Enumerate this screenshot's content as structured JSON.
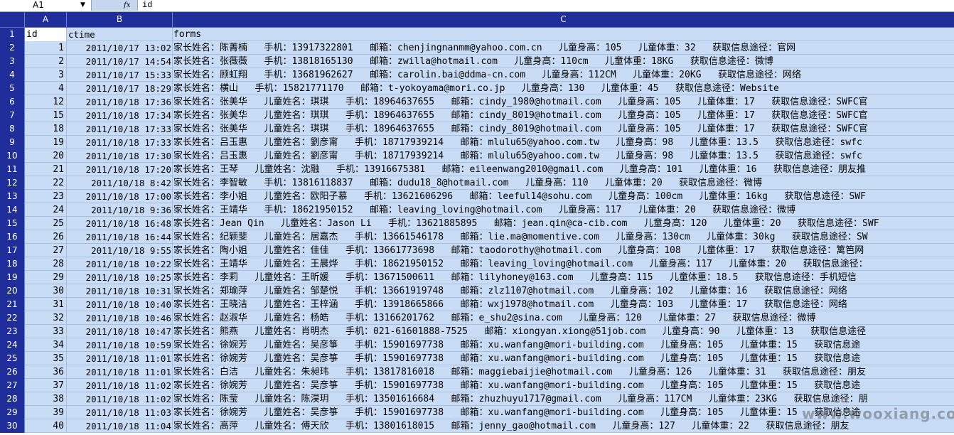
{
  "formula_bar": {
    "name_box": "A1",
    "fx_label": "fx",
    "formula": "id"
  },
  "columns": [
    "A",
    "B",
    "C"
  ],
  "header_row": {
    "row_num": "1",
    "a": "id",
    "b": "ctime",
    "c": "forms"
  },
  "rows": [
    {
      "n": "2",
      "a": "1",
      "b": "2011/10/17 13:02",
      "c": "家长姓名：陈菁楠   手机：13917322801   邮箱：chenjingnanmm@yahoo.com.cn   儿童身高：105   儿童体重：32   获取信息途径：官网"
    },
    {
      "n": "3",
      "a": "2",
      "b": "2011/10/17 14:54",
      "c": "家长姓名：张薇薇   手机：13818165130   邮箱：zwilla@hotmail.com   儿童身高：110cm   儿童体重：18KG   获取信息途径：微博"
    },
    {
      "n": "4",
      "a": "3",
      "b": "2011/10/17 15:33",
      "c": "家长姓名：顾虹翔   手机：13681962627   邮箱：carolin.bai@ddma-cn.com   儿童身高：112CM   儿童体重：20KG   获取信息途径：网络"
    },
    {
      "n": "5",
      "a": "4",
      "b": "2011/10/17 18:29",
      "c": "家长姓名：横山   手机：15821771170   邮箱：t-yokoyama@mori.co.jp   儿童身高：130   儿童体重：45   获取信息途径：Website"
    },
    {
      "n": "6",
      "a": "12",
      "b": "2011/10/18 17:36",
      "c": "家长姓名：张美华   儿童姓名：琪琪   手机：18964637655   邮箱：cindy_1980@hotmail.com   儿童身高：105   儿童体重：17   获取信息途径：SWFC官"
    },
    {
      "n": "7",
      "a": "15",
      "b": "2011/10/18 17:34",
      "c": "家长姓名：张美华   儿童姓名：琪琪   手机：18964637655   邮箱：cindy_8019@hotmail.com   儿童身高：105   儿童体重：17   获取信息途径：SWFC官"
    },
    {
      "n": "8",
      "a": "18",
      "b": "2011/10/18 17:33",
      "c": "家长姓名：张美华   儿童姓名：琪琪   手机：18964637655   邮箱：cindy_8019@hotmail.com   儿童身高：105   儿童体重：17   获取信息途径：SWFC官"
    },
    {
      "n": "9",
      "a": "19",
      "b": "2011/10/18 17:33",
      "c": "家长姓名：吕玉惠   儿童姓名：劉彦甯   手机：18717939214   邮箱：mlulu65@yahoo.com.tw   儿童身高：98   儿童体重：13.5   获取信息途径：swfc"
    },
    {
      "n": "10",
      "a": "20",
      "b": "2011/10/18 17:30",
      "c": "家长姓名：吕玉惠   儿童姓名：劉彦甯   手机：18717939214   邮箱：mlulu65@yahoo.com.tw   儿童身高：98   儿童体重：13.5   获取信息途径：swfc"
    },
    {
      "n": "11",
      "a": "21",
      "b": "2011/10/18 17:20",
      "c": "家长姓名：王琴   儿童姓名：沈融   手机：13916675381   邮箱：eileenwang2010@gmail.com   儿童身高：101   儿童体重：16   获取信息途径：朋友推"
    },
    {
      "n": "12",
      "a": "22",
      "b": "2011/10/18 8:42",
      "c": "家长姓名：李智敏   手机：13816118837   邮箱：dudu18_8@hotmail.com   儿童身高：110   儿童体重：20   获取信息途径：微博"
    },
    {
      "n": "13",
      "a": "23",
      "b": "2011/10/18 17:00",
      "c": "家长姓名：李小姐   儿童姓名：欧阳子慕   手机：13621606296   邮箱：leeful14@sohu.com   儿童身高：100cm   儿童体重：16kg   获取信息途径：SWF"
    },
    {
      "n": "14",
      "a": "24",
      "b": "2011/10/18 9:36",
      "c": "家长姓名：王靖华   手机：18621950152   邮箱：leaving_loving@hotmail.com   儿童身高：117   儿童体重：20   获取信息途径：微博"
    },
    {
      "n": "15",
      "a": "25",
      "b": "2011/10/18 16:48",
      "c": "家长姓名：Jean Qin   儿童姓名：Jason Li   手机：13621885895   邮箱：jean.qin@ca-cib.com   儿童身高：120   儿童体重：20   获取信息途径：SWF"
    },
    {
      "n": "16",
      "a": "26",
      "b": "2011/10/18 16:44",
      "c": "家长姓名：纪颖斐   儿童姓名：居嘉杰   手机：13661546178   邮箱：lie.ma@momentive.com   儿童身高：130cm   儿童体重：30kg   获取信息途径：SW"
    },
    {
      "n": "17",
      "a": "27",
      "b": "2011/10/18 9:55",
      "c": "家长姓名：陶小姐   儿童姓名：佳佳   手机：13661773698   邮箱：taodorothy@hotmail.com   儿童身高：108   儿童体重：17   获取信息途径：篱笆网"
    },
    {
      "n": "18",
      "a": "28",
      "b": "2011/10/18 10:22",
      "c": "家长姓名：王靖华   儿童姓名：王晨烨   手机：18621950152   邮箱：leaving_loving@hotmail.com   儿童身高：117   儿童体重：20   获取信息途径："
    },
    {
      "n": "19",
      "a": "29",
      "b": "2011/10/18 10:25",
      "c": "家长姓名：李莉   儿童姓名：王昕媛   手机：13671500611   邮箱：lilyhoney@163.com   儿童身高：115   儿童体重：18.5   获取信息途径：手机短信"
    },
    {
      "n": "20",
      "a": "30",
      "b": "2011/10/18 10:31",
      "c": "家长姓名：郑瑜萍   儿童姓名：邹楚悦   手机：13661919748   邮箱：zlz1107@hotmail.com   儿童身高：102   儿童体重：16   获取信息途径：网络"
    },
    {
      "n": "21",
      "a": "31",
      "b": "2011/10/18 10:40",
      "c": "家长姓名：王晓洁   儿童姓名：王梓涵   手机：13918665866   邮箱：wxj1978@hotmail.com   儿童身高：103   儿童体重：17   获取信息途径：网络"
    },
    {
      "n": "22",
      "a": "32",
      "b": "2011/10/18 10:46",
      "c": "家长姓名：赵淑华   儿童姓名：杨皓   手机：13166201762   邮箱：e_shu2@sina.com   儿童身高：120   儿童体重：27   获取信息途径：微博"
    },
    {
      "n": "23",
      "a": "33",
      "b": "2011/10/18 10:47",
      "c": "家长姓名：熊燕   儿童姓名：肖明杰   手机：021-61601888-7525   邮箱：xiongyan.xiong@51job.com   儿童身高：90   儿童体重：13   获取信息途径"
    },
    {
      "n": "24",
      "a": "34",
      "b": "2011/10/18 10:59",
      "c": "家长姓名：徐婉芳   儿童姓名：吴彦箏   手机：15901697738   邮箱：xu.wanfang@mori-building.com   儿童身高：105   儿童体重：15   获取信息途"
    },
    {
      "n": "25",
      "a": "35",
      "b": "2011/10/18 11:01",
      "c": "家长姓名：徐婉芳   儿童姓名：吴彦箏   手机：15901697738   邮箱：xu.wanfang@mori-building.com   儿童身高：105   儿童体重：15   获取信息途"
    },
    {
      "n": "26",
      "a": "36",
      "b": "2011/10/18 11:01",
      "c": "家长姓名：白洁   儿童姓名：朱昶玮   手机：13817816018   邮箱：maggiebaijie@hotmail.com   儿童身高：126   儿童体重：31   获取信息途径：朋友"
    },
    {
      "n": "27",
      "a": "37",
      "b": "2011/10/18 11:02",
      "c": "家长姓名：徐婉芳   儿童姓名：吴彦箏   手机：15901697738   邮箱：xu.wanfang@mori-building.com   儿童身高：105   儿童体重：15   获取信息途"
    },
    {
      "n": "28",
      "a": "38",
      "b": "2011/10/18 11:02",
      "c": "家长姓名：陈莹   儿童姓名：陈淏玥   手机：13501616684   邮箱：zhuzhuyu1717@gmail.com   儿童身高：117CM   儿童体重：23KG   获取信息途径：朋"
    },
    {
      "n": "29",
      "a": "39",
      "b": "2011/10/18 11:03",
      "c": "家长姓名：徐婉芳   儿童姓名：吴彦箏   手机：15901697738   邮箱：xu.wanfang@mori-building.com   儿童身高：105   儿童体重：15   获取信息途"
    },
    {
      "n": "30",
      "a": "40",
      "b": "2011/10/18 11:04",
      "c": "家长姓名：高萍   儿童姓名：傅天欣   手机：13801618015   邮箱：jenny_gao@hotmail.com   儿童身高：127   儿童体重：22   获取信息途径：朋友"
    }
  ],
  "watermark": "www.wooxiang.com"
}
